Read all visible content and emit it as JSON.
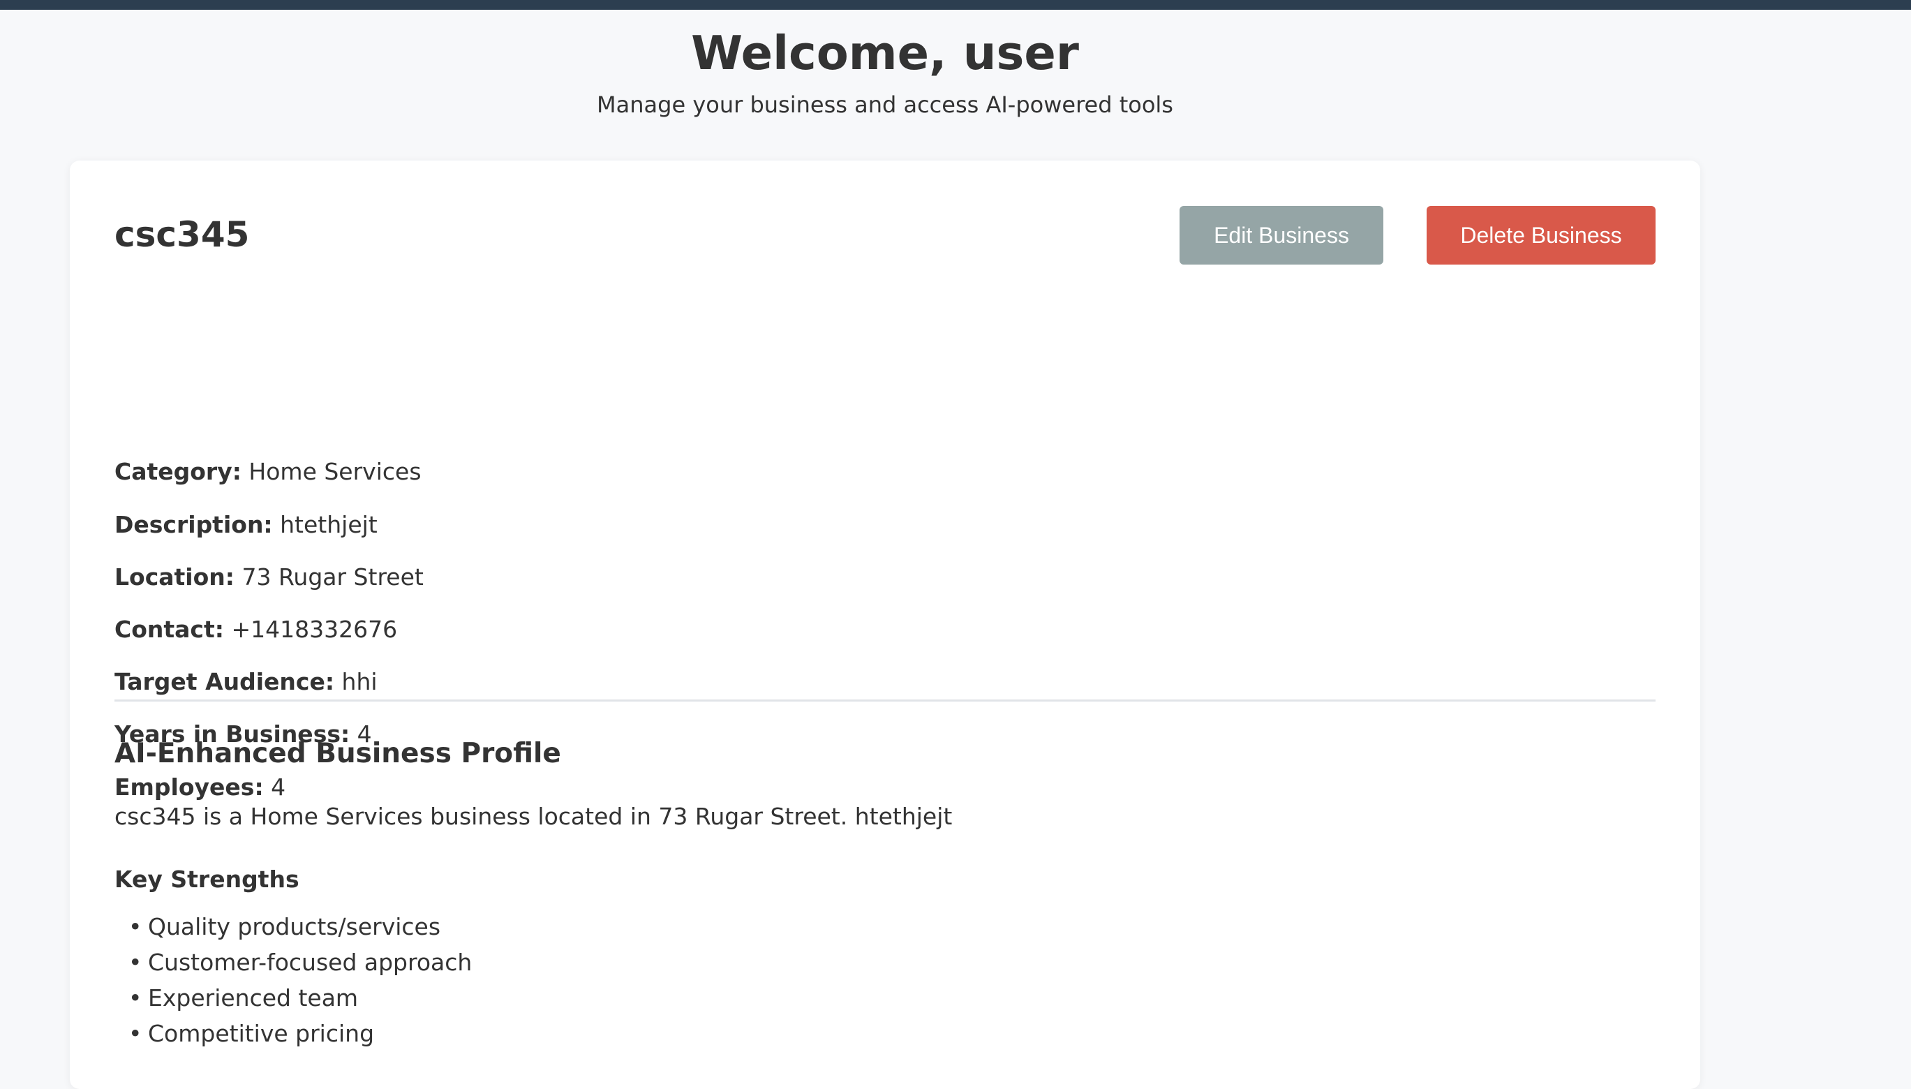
{
  "header": {
    "title": "Welcome, user",
    "subtitle": "Manage your business and access AI-powered tools"
  },
  "business": {
    "name": "csc345",
    "edit_label": "Edit Business",
    "delete_label": "Delete Business",
    "details": [
      {
        "label": "Category:",
        "value": "Home Services"
      },
      {
        "label": "Description:",
        "value": "htethjejt"
      },
      {
        "label": "Location:",
        "value": "73 Rugar Street"
      },
      {
        "label": "Contact:",
        "value": "+1418332676"
      },
      {
        "label": "Target Audience:",
        "value": "hhi"
      },
      {
        "label": "Years in Business:",
        "value": "4"
      },
      {
        "label": "Employees:",
        "value": "4"
      }
    ]
  },
  "ai_profile": {
    "title": "AI-Enhanced Business Profile",
    "summary": "csc345 is a Home Services business located in 73 Rugar Street. htethjejt",
    "strengths_title": "Key Strengths",
    "strengths": [
      "Quality products/services",
      "Customer-focused approach",
      "Experienced team",
      "Competitive pricing"
    ]
  },
  "colors": {
    "top_bar": "#2c3e50",
    "edit_button": "#95a5a6",
    "delete_button": "#d9594a",
    "background": "#f7f8fa"
  }
}
